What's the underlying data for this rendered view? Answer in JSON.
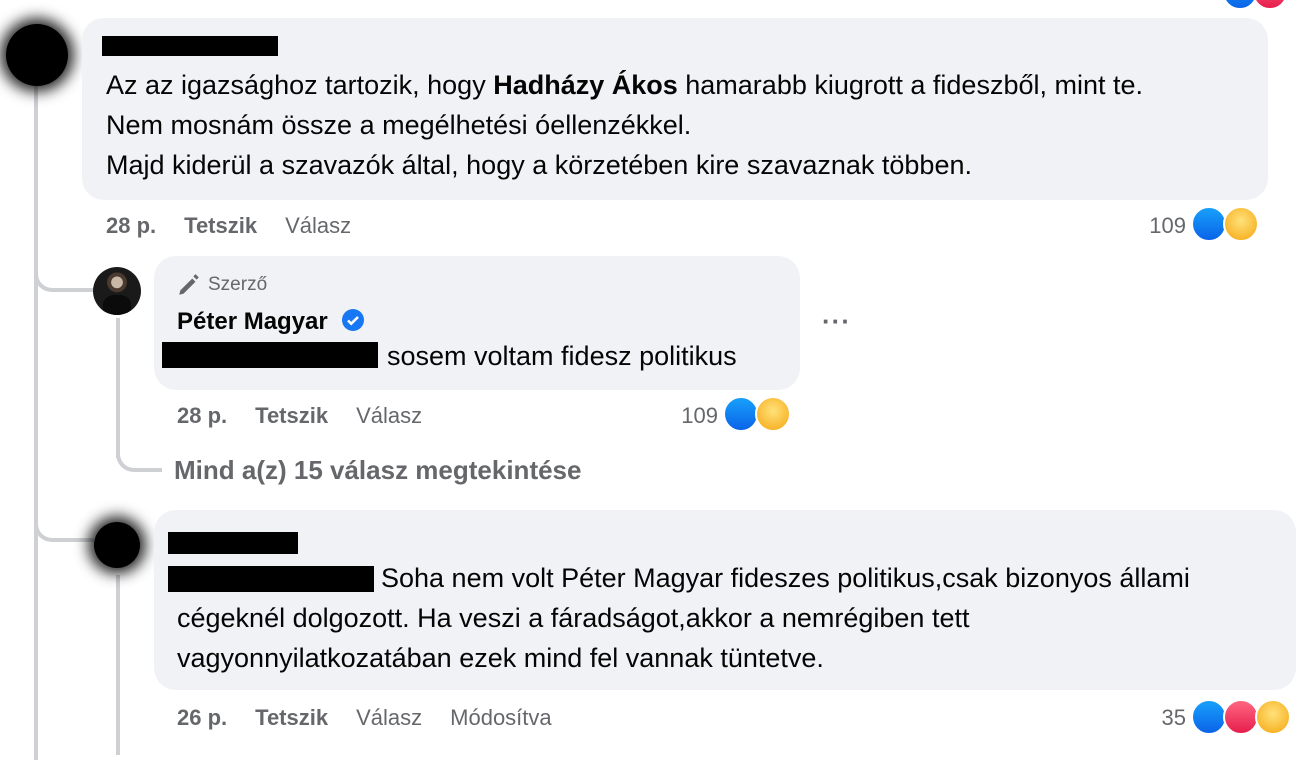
{
  "comment1": {
    "lines_pre": "Az az igazsághoz tartozik, hogy ",
    "bold_name": "Hadházy Ákos",
    "lines_post": " hamarabb kiugrott a fideszből, mint te.",
    "line2": "Nem mosnám össze a megélhetési óellenzékkel.",
    "line3": "Majd kiderül a szavazók által, hogy a körzetében kire szavaznak többen.",
    "time": "28 p.",
    "like_label": "Tetszik",
    "reply_label": "Válasz",
    "reaction_count": "109",
    "reactions": [
      "like-icon",
      "haha-icon"
    ]
  },
  "reply1": {
    "author_badge": "Szerző",
    "author_name": "Péter Magyar",
    "text": "sosem voltam fidesz politikus",
    "time": "28 p.",
    "like_label": "Tetszik",
    "reply_label": "Válasz",
    "reaction_count": "109",
    "reactions": [
      "like-icon",
      "haha-icon"
    ],
    "more_label": "···"
  },
  "view_all_replies": "Mind a(z) 15 válasz megtekintése",
  "comment2": {
    "line1": "Soha nem volt Péter Magyar fideszes politikus,csak bizonyos állami",
    "line2": "cégeknél dolgozott. Ha veszi a fáradságot,akkor a nemrégiben tett",
    "line3": "vagyonnyilatkozatában ezek mind fel vannak tüntetve.",
    "time": "26 p.",
    "like_label": "Tetszik",
    "reply_label": "Válasz",
    "edited_label": "Módosítva",
    "reaction_count": "35",
    "reactions": [
      "like-icon",
      "love-icon",
      "wow-icon"
    ]
  },
  "colors": {
    "bubble": "#f0f2f5",
    "meta_text": "#65676b",
    "like_blue": "#0866ff",
    "verified_blue": "#1877f2"
  }
}
